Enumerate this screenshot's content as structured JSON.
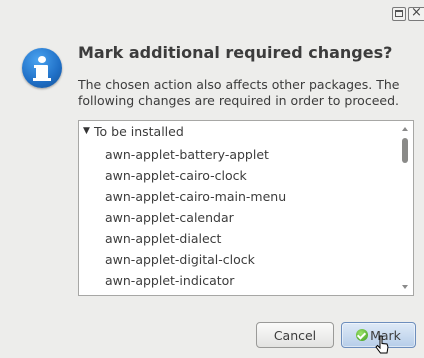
{
  "dialog": {
    "title": "Mark additional required changes?",
    "description": "The chosen action also affects other packages. The following changes are required in order to proceed."
  },
  "list": {
    "group_label": "To be installed",
    "expander_glyph": "▼",
    "items": [
      "awn-applet-battery-applet",
      "awn-applet-cairo-clock",
      "awn-applet-cairo-main-menu",
      "awn-applet-calendar",
      "awn-applet-dialect",
      "awn-applet-digital-clock",
      "awn-applet-indicator"
    ]
  },
  "buttons": {
    "cancel_label": "Cancel",
    "mark_label": "Mark"
  },
  "window_controls": {
    "close_glyph": "×"
  },
  "icons": {
    "dialog_icon": "info-icon",
    "mark_icon": "check-icon"
  },
  "colors": {
    "info_blue": "#1f6fc6",
    "mark_button": "#b6cde9",
    "check_green": "#3e9a1e"
  }
}
